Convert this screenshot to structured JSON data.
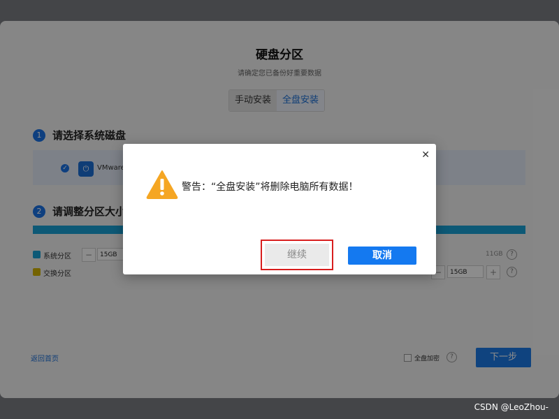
{
  "header": {
    "title": "硬盘分区",
    "subtitle": "请确定您已备份好重要数据"
  },
  "mode_tabs": [
    {
      "label": "手动安装"
    },
    {
      "label": "全盘安装"
    }
  ],
  "steps": {
    "step1": {
      "number": "1",
      "label": "请选择系统磁盘"
    },
    "step2": {
      "number": "2",
      "label": "请调整分区大小"
    }
  },
  "disk": {
    "name": "VMware,"
  },
  "partitions": [
    {
      "label": "系统分区",
      "color": "#18a3d8",
      "size": "15GB",
      "total": "11GB"
    },
    {
      "label": "交换分区",
      "color": "#d4b400",
      "size": "15GB"
    }
  ],
  "footer": {
    "back_link": "返回首页",
    "encrypt_label": "全盘加密",
    "next_button": "下一步"
  },
  "dialog": {
    "message": "警告：“全盘安装”将删除电脑所有数据！",
    "continue_button": "继续",
    "cancel_button": "取消",
    "close_symbol": "✕"
  },
  "watermark": "CSDN @LeoZhou-",
  "colors": {
    "accent": "#1479f0",
    "warning": "#f5a623",
    "highlight_border": "#d81e1e"
  }
}
